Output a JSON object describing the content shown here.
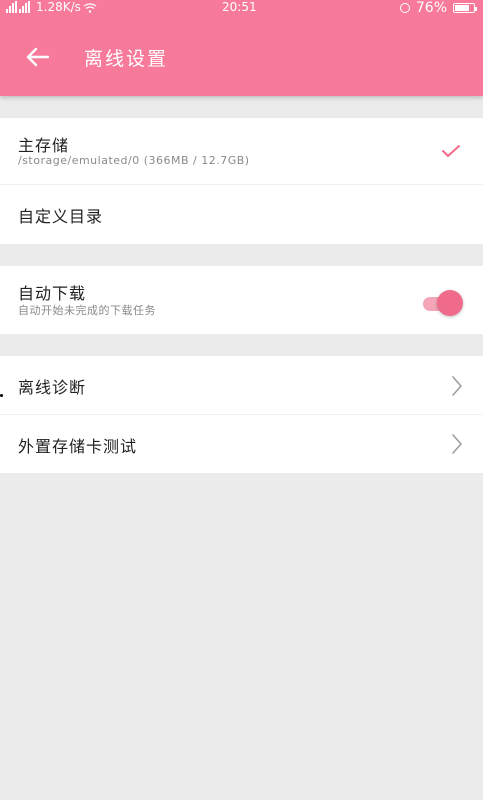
{
  "status": {
    "net_speed": "1.28K/s",
    "time": "20:51",
    "battery": "76%",
    "battery_level": 0.76
  },
  "header": {
    "title": "离线设置"
  },
  "storage": {
    "main_label": "主存储",
    "main_path": "/storage/emulated/0 (366MB / 12.7GB)",
    "custom_label": "自定义目录"
  },
  "download": {
    "label": "自动下载",
    "desc": "自动开始未完成的下载任务",
    "enabled": true
  },
  "tools": {
    "diagnose_label": "离线诊断",
    "sdcard_label": "外置存储卡测试"
  },
  "colors": {
    "accent": "#f77a9a",
    "toggle_on": "#f06a8c"
  }
}
